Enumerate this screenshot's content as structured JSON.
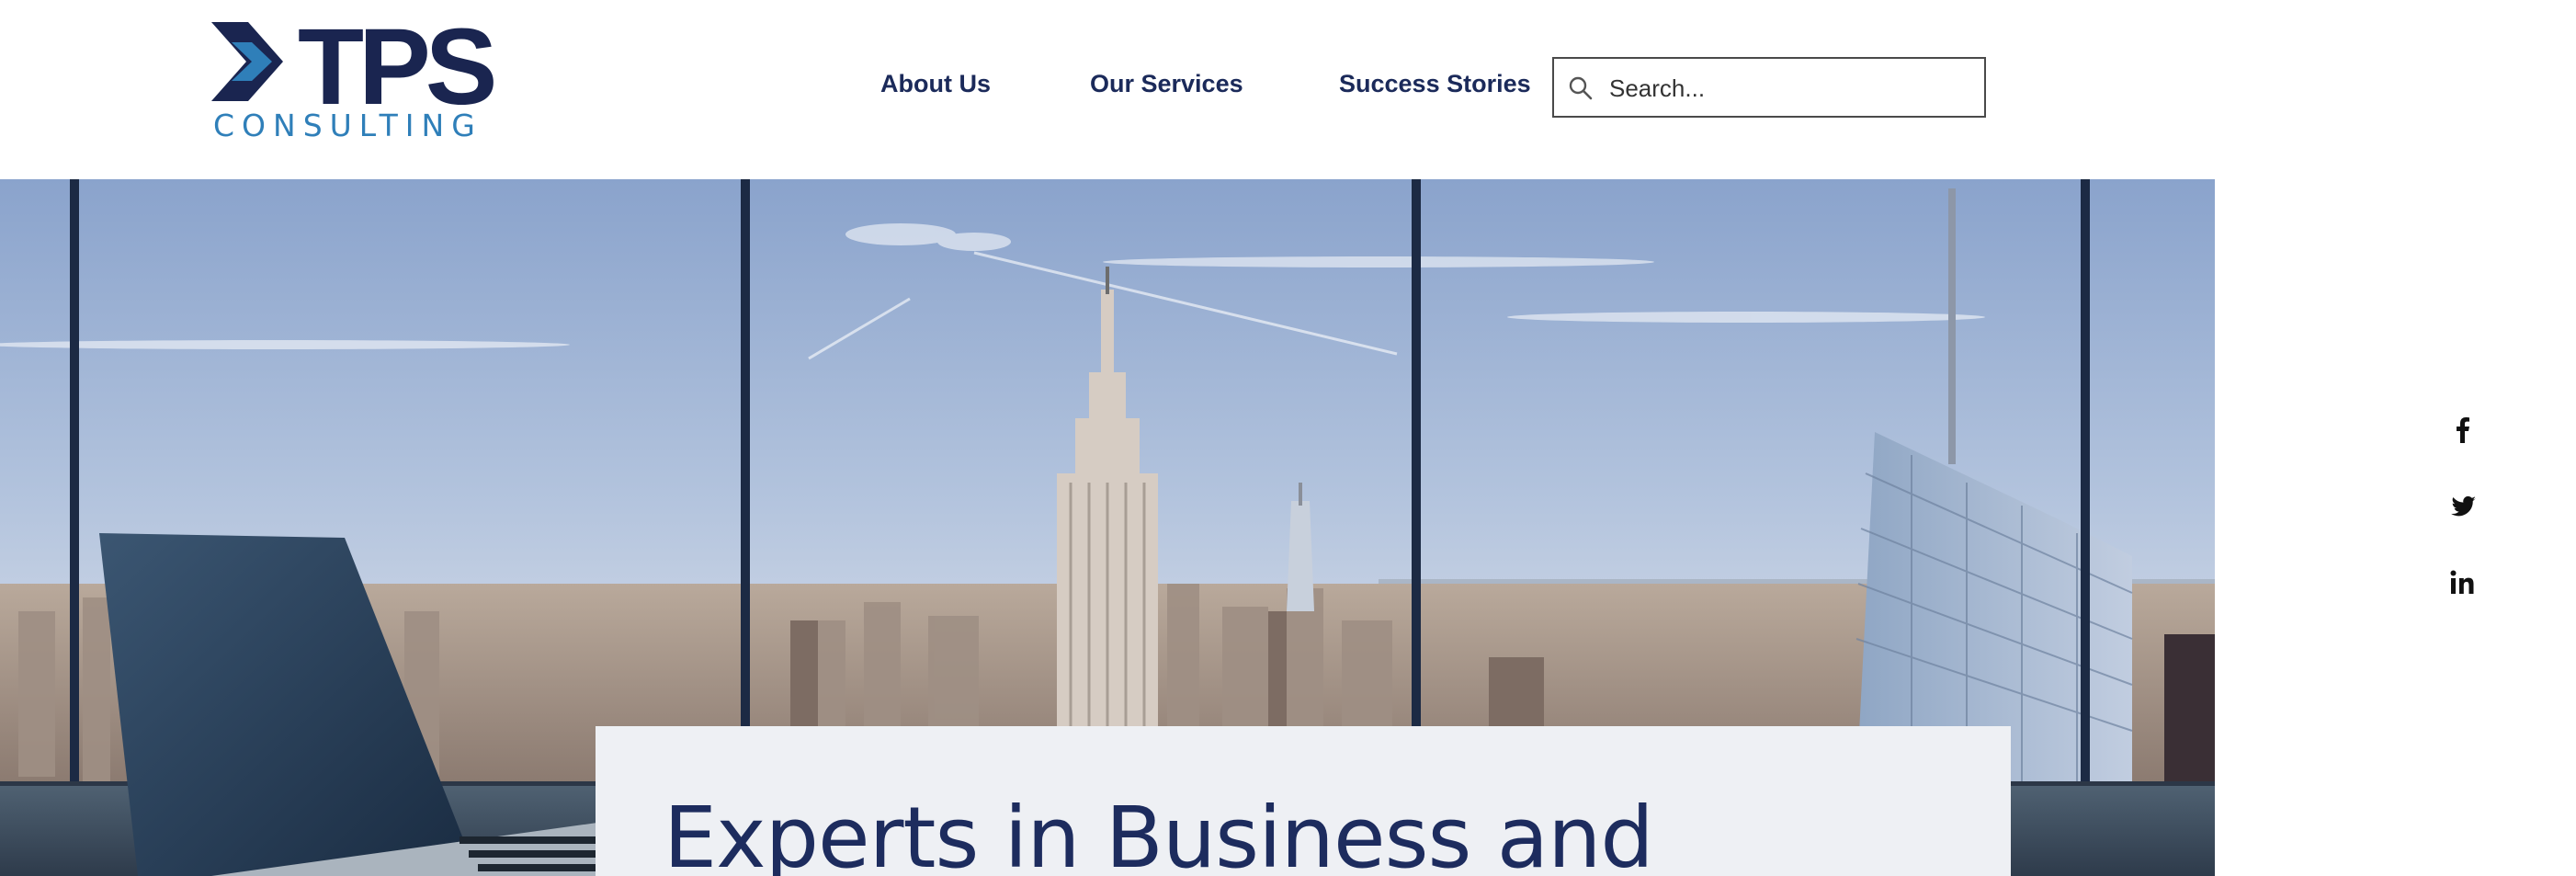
{
  "brand": {
    "logo_word": "TPS",
    "logo_sub": "CONSULTING",
    "colors": {
      "navy": "#1a2550",
      "blue": "#2f7fb9"
    }
  },
  "nav": {
    "items": [
      {
        "label": "About Us"
      },
      {
        "label": "Our Services"
      },
      {
        "label": "Success Stories"
      }
    ]
  },
  "search": {
    "placeholder": "Search...",
    "value": "",
    "icon": "search-icon"
  },
  "hero": {
    "image": "city-skyline-office-window",
    "title": "Experts in Business and"
  },
  "social": {
    "icons": [
      "facebook-icon",
      "twitter-icon",
      "linkedin-icon"
    ]
  }
}
